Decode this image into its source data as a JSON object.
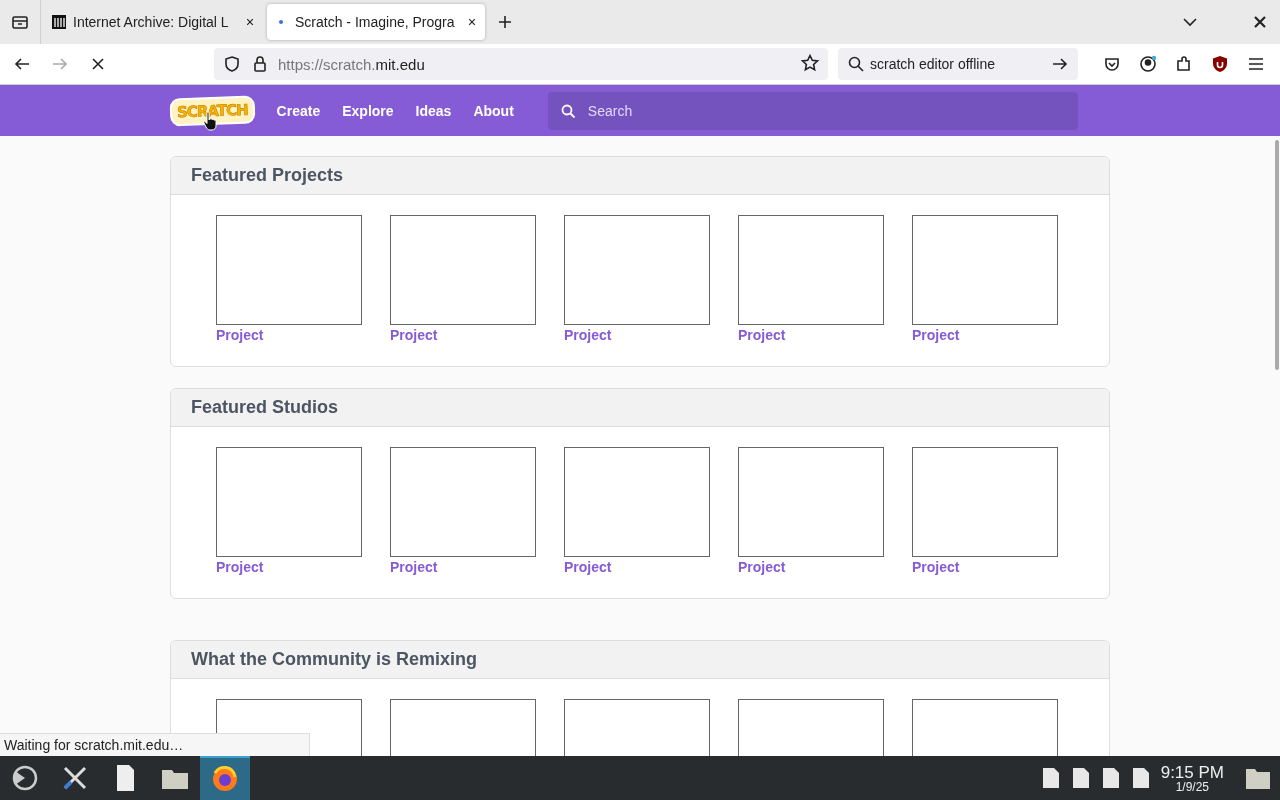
{
  "browser": {
    "tabs": [
      {
        "title": "Internet Archive: Digital L",
        "selected": false,
        "loading": false
      },
      {
        "title": "Scratch - Imagine, Progra",
        "selected": true,
        "loading": true
      }
    ],
    "url": {
      "host_prefix": "https://scratch.",
      "domain": "mit.edu"
    },
    "search": {
      "value": "scratch editor offline"
    },
    "status": "Waiting for scratch.mit.edu…"
  },
  "header": {
    "logo": "SCRATCH",
    "nav": [
      "Create",
      "Explore",
      "Ideas",
      "About"
    ],
    "search": {
      "placeholder": "Search"
    }
  },
  "sections": [
    {
      "title": "Featured Projects",
      "items": [
        {
          "kind": "project",
          "label": "Project"
        },
        {
          "kind": "project",
          "label": "Project"
        },
        {
          "kind": "project",
          "label": "Project"
        },
        {
          "kind": "project",
          "label": "Project"
        },
        {
          "kind": "project",
          "label": "Project"
        }
      ]
    },
    {
      "title": "Featured Studios",
      "items": [
        {
          "kind": "project",
          "label": "Project"
        },
        {
          "kind": "project",
          "label": "Project"
        },
        {
          "kind": "project",
          "label": "Project"
        },
        {
          "kind": "project",
          "label": "Project"
        },
        {
          "kind": "project",
          "label": "Project"
        }
      ]
    },
    {
      "title": "What the Community is Remixing",
      "items": [
        {
          "kind": "thumbnail"
        },
        {
          "kind": "thumbnail"
        },
        {
          "kind": "thumbnail"
        },
        {
          "kind": "thumbnail"
        },
        {
          "kind": "thumbnail"
        }
      ]
    }
  ],
  "taskbar": {
    "apps": [
      {
        "kind": "launcher",
        "selected": false
      },
      {
        "kind": "settings",
        "selected": false
      },
      {
        "kind": "document",
        "selected": false
      },
      {
        "kind": "folder",
        "selected": false
      },
      {
        "kind": "browser",
        "selected": true
      }
    ],
    "time": "9:15 PM",
    "date": "1/9/25"
  }
}
